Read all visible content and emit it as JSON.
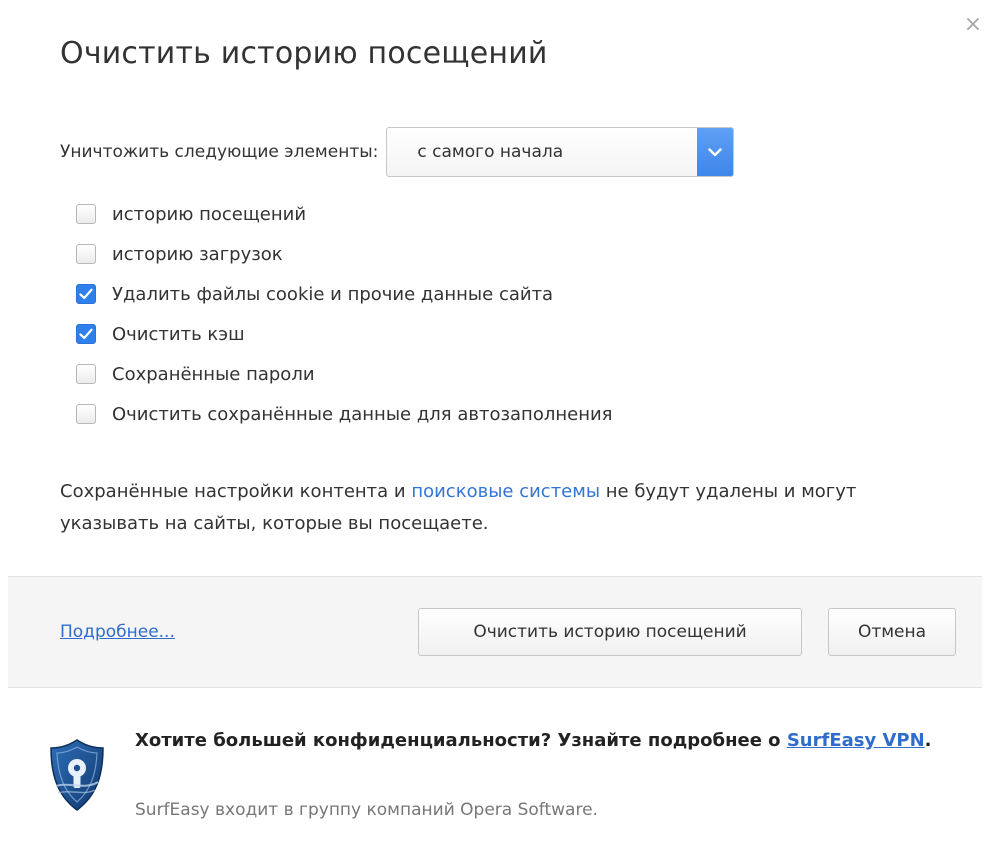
{
  "dialog": {
    "title": "Очистить историю посещений",
    "close_label": "×"
  },
  "range": {
    "label": "Уничтожить следующие элементы:",
    "selected": "с самого начала"
  },
  "items": [
    {
      "label": "историю посещений",
      "checked": false
    },
    {
      "label": "историю загрузок",
      "checked": false
    },
    {
      "label": "Удалить файлы cookie и прочие данные сайта",
      "checked": true
    },
    {
      "label": "Очистить кэш",
      "checked": true
    },
    {
      "label": "Сохранённые пароли",
      "checked": false
    },
    {
      "label": "Очистить сохранённые данные для автозаполнения",
      "checked": false
    }
  ],
  "note": {
    "part1": "Сохранённые настройки контента и ",
    "link": "поисковые системы",
    "part2": " не будут удалены и могут указывать на сайты, которые вы посещаете."
  },
  "footer": {
    "more_link": "Подробнее...",
    "clear_button": "Очистить историю посещений",
    "cancel_button": "Отмена"
  },
  "promo": {
    "headline": "Хотите большей конфиденциальности? Узнайте подробнее о ",
    "link": "SurfEasy VPN",
    "headline_end": ".",
    "sub": "SurfEasy входит в группу компаний Opera Software."
  },
  "colors": {
    "accent": "#2f80ed",
    "link": "#3474d3",
    "footer_bg": "#f5f5f5"
  }
}
